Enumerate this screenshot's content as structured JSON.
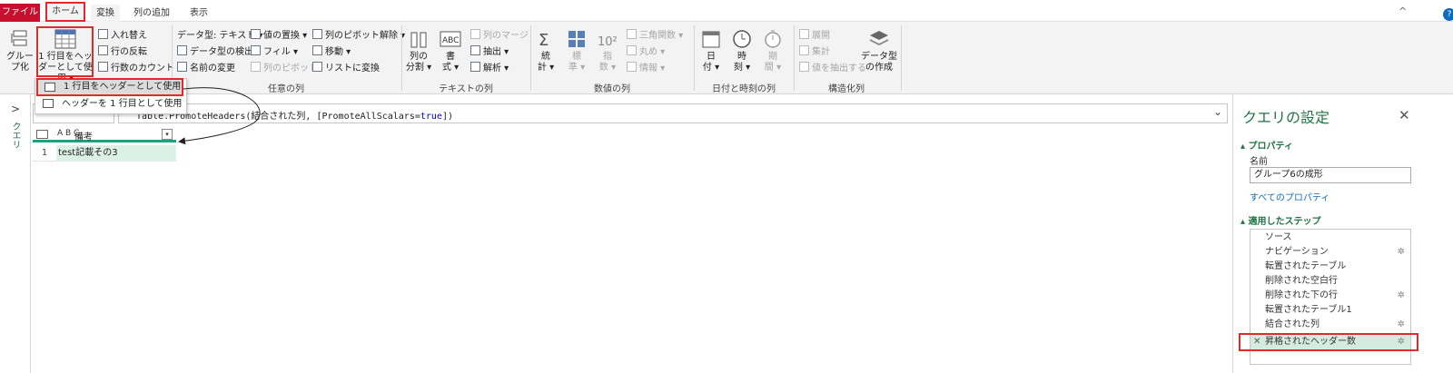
{
  "tabs": {
    "file": "ファイル",
    "home": "ホーム",
    "transform": "変換",
    "add_column": "列の追加",
    "view": "表示"
  },
  "window": {
    "collapse": "^",
    "help": "?"
  },
  "ribbon": {
    "group_table": {
      "btn_group_l1": "グルー",
      "btn_group_l2": "プ化",
      "btn_first_row_l1": "1 行目をヘッ",
      "btn_first_row_l2": "ダーとして使用 ▾",
      "transpose": "入れ替え",
      "reverse_rows": "行の反転",
      "count_rows": "行数のカウント"
    },
    "group_any_column": {
      "label": "任意の列",
      "data_type": "データ型: テキスト ▾",
      "detect_type": "データ型の検出",
      "rename": "名前の変更",
      "replace_values": "値の置換 ▾",
      "fill": "フィル ▾",
      "pivot_column": "列のピボット",
      "unpivot": "列のピボット解除 ▾",
      "move": "移動 ▾",
      "to_list": "リストに変換"
    },
    "group_text_column": {
      "label": "テキストの列",
      "split_l1": "列の",
      "split_l2": "分割 ▾",
      "format_l1": "書",
      "format_l2": "式 ▾",
      "merge": "列のマージ",
      "extract": "抽出 ▾",
      "parse": "解析 ▾"
    },
    "group_number_column": {
      "label": "数値の列",
      "stats_l1": "統",
      "stats_l2": "計 ▾",
      "standard_l1": "標",
      "standard_l2": "準 ▾",
      "scientific_l1": "指",
      "scientific_l2": "数 ▾",
      "trig": "三角関数 ▾",
      "rounding": "丸め ▾",
      "info": "情報 ▾"
    },
    "group_datetime": {
      "label": "日付と時刻の列",
      "date_l1": "日",
      "date_l2": "付 ▾",
      "time_l1": "時",
      "time_l2": "刻 ▾",
      "duration_l1": "期",
      "duration_l2": "間 ▾"
    },
    "group_structured": {
      "label": "構造化列",
      "expand": "展開",
      "aggregate": "集計",
      "extract_values": "値を抽出する",
      "create_type_l1": "データ型",
      "create_type_l2": "の作成"
    }
  },
  "dropdown": {
    "use_first_row": "1 行目をヘッダーとして使用",
    "use_headers_as_first_row": "ヘッダーを 1 行目として使用"
  },
  "left_pane": {
    "label": "クエリ",
    "chevron": ">"
  },
  "formula": {
    "fx": "fx",
    "before": "Table.PromoteHeaders(結合された列, [PromoteAllScalars=",
    "keyword": "true",
    "after": "])",
    "expand": "⌄"
  },
  "grid": {
    "column_type": "A B C",
    "column_name": "備考",
    "filter": "▾",
    "row_number": "1",
    "cell_value": "test記載その3"
  },
  "settings": {
    "title": "クエリの設定",
    "close": "✕",
    "properties_title": "プロパティ",
    "name_label": "名前",
    "name_value": "グループ6の成形",
    "all_properties": "すべてのプロパティ",
    "applied_steps_title": "適用したステップ",
    "steps": [
      {
        "label": "ソース",
        "gear": ""
      },
      {
        "label": "ナビゲーション",
        "gear": "✲"
      },
      {
        "label": "転置されたテーブル",
        "gear": ""
      },
      {
        "label": "削除された空白行",
        "gear": ""
      },
      {
        "label": "削除された下の行",
        "gear": "✲"
      },
      {
        "label": "転置されたテーブル1",
        "gear": ""
      },
      {
        "label": "結合された列",
        "gear": "✲"
      },
      {
        "label": "昇格されたヘッダー数",
        "gear": "✲"
      }
    ],
    "active_step_delete": "✕"
  },
  "colors": {
    "accent_red": "#e02b2b",
    "file_tab": "#c8102e",
    "brand_green": "#217346",
    "selection_green": "#1aa37f",
    "link_blue": "#0f6cbd"
  }
}
